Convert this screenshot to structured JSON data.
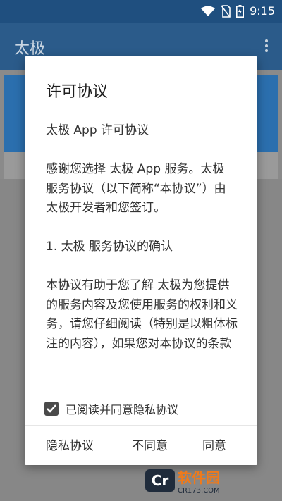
{
  "status_bar": {
    "time": "9:15",
    "icons": [
      "wifi-icon",
      "no-sim-icon",
      "battery-charging-icon"
    ]
  },
  "app_bar": {
    "title": "太极",
    "menu_icon": "more-vert-icon"
  },
  "dialog": {
    "title": "许可协议",
    "paragraphs": [
      "太极 App 许可协议",
      "感谢您选择 太极 App 服务。太极 服务协议（以下简称“本协议”）由 太极开发者和您签订。",
      "1. 太极 服务协议的确认",
      "本协议有助于您了解 太极为您提供的服务内容及您使用服务的权利和义务，请您仔细阅读（特别是以粗体标注的内容），如果您对本协议的条款"
    ],
    "consent": {
      "checked": true,
      "label": "已阅读并同意隐私协议"
    },
    "buttons": {
      "privacy": "隐私协议",
      "disagree": "不同意",
      "agree": "同意"
    }
  },
  "watermark": {
    "main": "软件园",
    "sub": "CR173.COM"
  },
  "colors": {
    "primary": "#2b5b8a",
    "accent": "#2b6fae",
    "checkbox": "#4a4a4a"
  }
}
